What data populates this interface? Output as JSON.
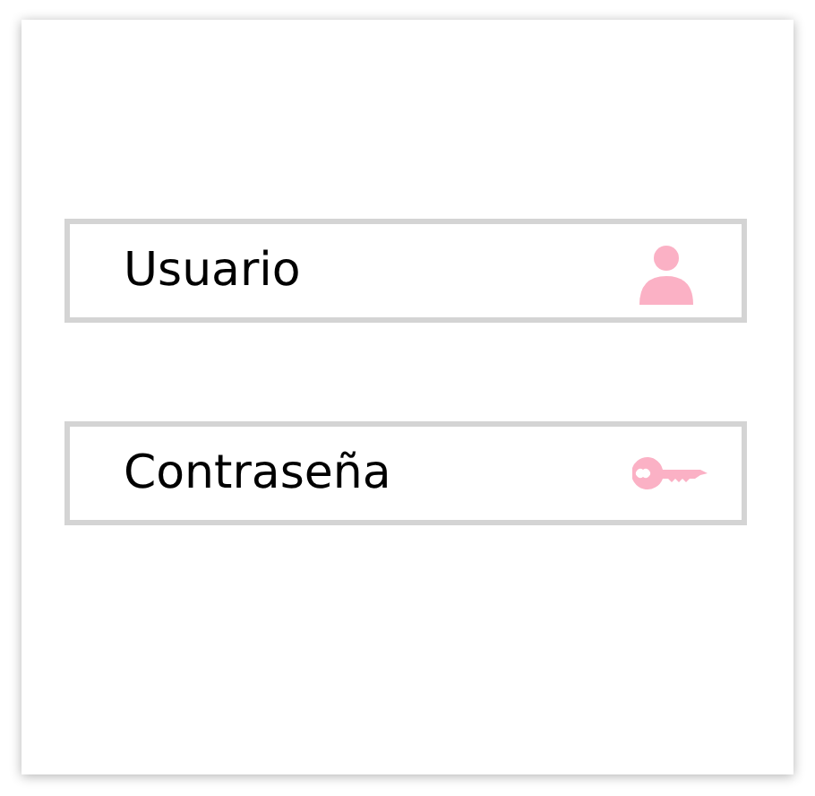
{
  "fields": [
    {
      "placeholder": "Usuario",
      "kind": "user"
    },
    {
      "placeholder": "Contraseña",
      "kind": "key"
    }
  ]
}
